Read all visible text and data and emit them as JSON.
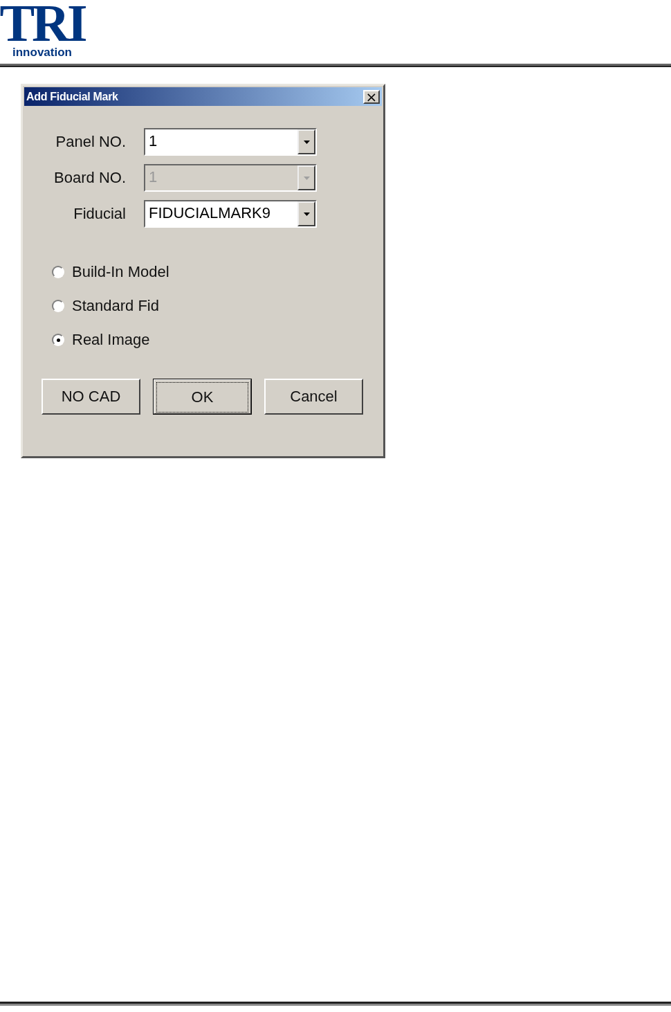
{
  "logo": {
    "mark": "TRI",
    "tagline": "innovation"
  },
  "dialog": {
    "title": "Add Fiducial Mark",
    "close": "×",
    "fields": [
      {
        "label": "Panel NO.",
        "value": "1",
        "disabled": false
      },
      {
        "label": "Board NO.",
        "value": "1",
        "disabled": true
      },
      {
        "label": "Fiducial",
        "value": "FIDUCIALMARK9",
        "disabled": false
      }
    ],
    "options": [
      {
        "label": "Build-In Model",
        "selected": false
      },
      {
        "label": "Standard Fid",
        "selected": false
      },
      {
        "label": "Real Image",
        "selected": true
      }
    ],
    "buttons": [
      {
        "label": "NO CAD",
        "default": false
      },
      {
        "label": "OK",
        "default": true
      },
      {
        "label": "Cancel",
        "default": false
      }
    ]
  }
}
